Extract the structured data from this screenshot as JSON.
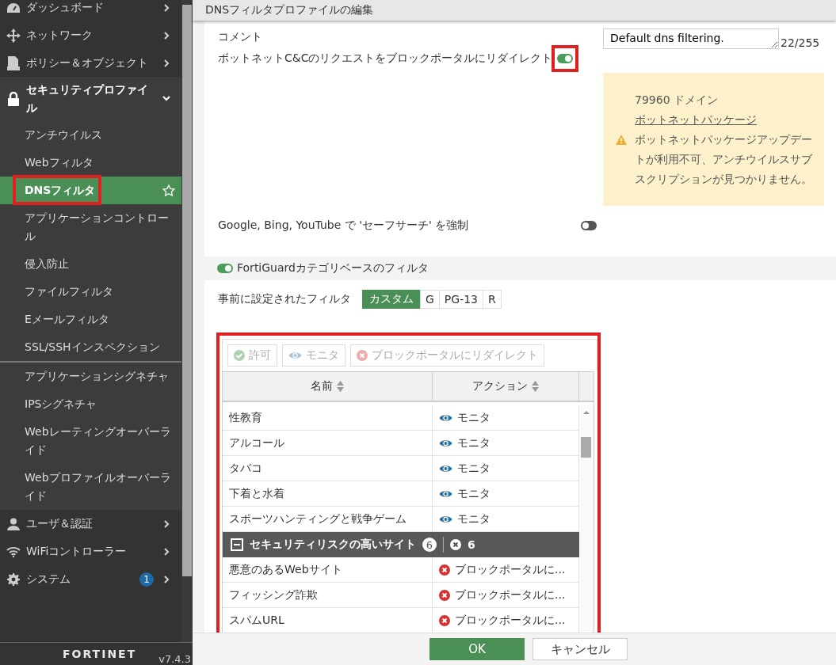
{
  "sidebar": {
    "items": [
      {
        "label": "ダッシュボード",
        "expanded": false
      },
      {
        "label": "ネットワーク",
        "expanded": false
      },
      {
        "label": "ポリシー＆オブジェクト",
        "expanded": false
      },
      {
        "label": "セキュリティプロファイル",
        "expanded": true,
        "children": [
          {
            "label": "アンチウイルス",
            "selected": false,
            "divider_before": false
          },
          {
            "label": "Webフィルタ",
            "selected": false,
            "divider_before": false
          },
          {
            "label": "DNSフィルタ",
            "selected": true,
            "divider_before": false,
            "highlighted": true
          },
          {
            "label": "アプリケーションコントロール",
            "selected": false,
            "divider_before": false
          },
          {
            "label": "侵入防止",
            "selected": false,
            "divider_before": false
          },
          {
            "label": "ファイルフィルタ",
            "selected": false,
            "divider_before": false
          },
          {
            "label": "Eメールフィルタ",
            "selected": false,
            "divider_before": false
          },
          {
            "label": "SSL/SSHインスペクション",
            "selected": false,
            "divider_before": false
          },
          {
            "label": "アプリケーションシグネチャ",
            "selected": false,
            "divider_before": true
          },
          {
            "label": "IPSシグネチャ",
            "selected": false,
            "divider_before": false
          },
          {
            "label": "Webレーティングオーバーライド",
            "selected": false,
            "divider_before": false
          },
          {
            "label": "Webプロファイルオーバーライド",
            "selected": false,
            "divider_before": false
          }
        ]
      },
      {
        "label": "ユーザ＆認証",
        "expanded": false
      },
      {
        "label": "WiFiコントローラー",
        "expanded": false
      },
      {
        "label": "システム",
        "expanded": false,
        "badge": "1"
      }
    ],
    "logo": "FORTINET",
    "version": "v7.4.3"
  },
  "header": {
    "title": "DNSフィルタプロファイルの編集"
  },
  "comment": {
    "label": "コメント",
    "value": "Default dns filtering.",
    "counter": "22/255"
  },
  "botnet": {
    "label": "ボットネットC&Cのリクエストをブロックポータルにリダイレクト",
    "on": true,
    "highlighted": true
  },
  "warning": {
    "text": "79960 ドメイン ",
    "link": "ボットネットパッケージ",
    "message": "ボットネットパッケージアップデートが利用不可、アンチウイルスサブスクリプションが見つかりません。"
  },
  "safe_search": {
    "label": "Google, Bing, YouTube で 'セーフサーチ' を強制",
    "on": false
  },
  "fortiguard": {
    "label": "FortiGuardカテゴリベースのフィルタ",
    "on": true
  },
  "preset": {
    "label": "事前に設定されたフィルタ",
    "options": [
      {
        "label": "カスタム",
        "selected": true
      },
      {
        "label": "G",
        "selected": false
      },
      {
        "label": "PG-13",
        "selected": false
      },
      {
        "label": "R",
        "selected": false
      }
    ]
  },
  "table": {
    "highlighted": true,
    "toolbar": [
      {
        "label": "許可",
        "kind": "allow",
        "disabled": true
      },
      {
        "label": "モニタ",
        "kind": "monitor",
        "disabled": true
      },
      {
        "label": "ブロックポータルにリダイレクト",
        "kind": "block",
        "disabled": true
      }
    ],
    "columns": [
      "名前",
      "アクション"
    ],
    "rows": [
      {
        "kind": "row",
        "name": "性教育",
        "action": {
          "kind": "monitor",
          "label": "モニタ"
        }
      },
      {
        "kind": "row",
        "name": "アルコール",
        "action": {
          "kind": "monitor",
          "label": "モニタ"
        }
      },
      {
        "kind": "row",
        "name": "タバコ",
        "action": {
          "kind": "monitor",
          "label": "モニタ"
        }
      },
      {
        "kind": "row",
        "name": "下着と水着",
        "action": {
          "kind": "monitor",
          "label": "モニタ"
        }
      },
      {
        "kind": "row",
        "name": "スポーツハンティングと戦争ゲーム",
        "action": {
          "kind": "monitor",
          "label": "モニタ"
        }
      },
      {
        "kind": "group",
        "name": "セキュリティリスクの高いサイト",
        "count": "6",
        "action": {
          "kind": "block",
          "label": "6"
        },
        "expanded": true
      },
      {
        "kind": "row",
        "name": "悪意のあるWebサイト",
        "action": {
          "kind": "block",
          "label": "ブロックポータルに..."
        }
      },
      {
        "kind": "row",
        "name": "フィッシング詐欺",
        "action": {
          "kind": "block",
          "label": "ブロックポータルに..."
        }
      },
      {
        "kind": "row",
        "name": "スパムURL",
        "action": {
          "kind": "block",
          "label": "ブロックポータルに..."
        }
      }
    ]
  },
  "buttons": [
    {
      "label": "OK",
      "kind": "primary"
    },
    {
      "label": "キャンセル",
      "kind": "secondary"
    }
  ]
}
